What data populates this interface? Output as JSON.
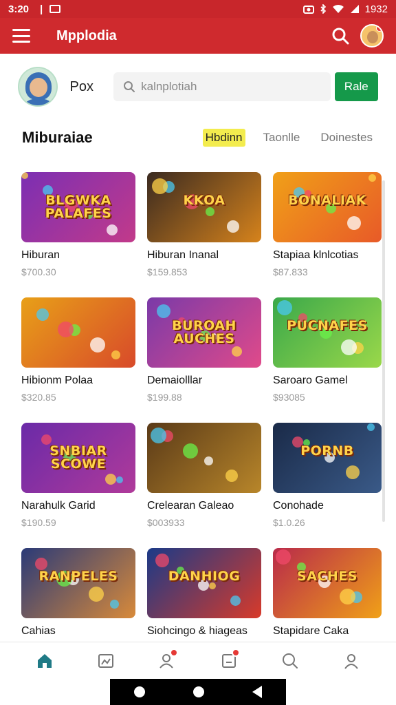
{
  "status_bar": {
    "time": "3:20",
    "clock_right": "1932"
  },
  "app": {
    "title": "Mpplodia"
  },
  "profile": {
    "name": "Pox"
  },
  "search": {
    "value": "kalnplotiah"
  },
  "rate_button": {
    "label": "Rale"
  },
  "section": {
    "title": "Miburaiae",
    "filters": [
      {
        "label": "Hbdinn",
        "active": true
      },
      {
        "label": "Taonlle",
        "active": false
      },
      {
        "label": "Doinestes",
        "active": false
      }
    ]
  },
  "games": [
    {
      "title": "Hiburan",
      "price": "$700.30",
      "art": "BLGWKA PALAFES",
      "colors": [
        "#7b2fb3",
        "#c23a8a"
      ]
    },
    {
      "title": "Hiburan Inanal",
      "price": "$159.853",
      "art": "KKOA",
      "colors": [
        "#3a2a20",
        "#d6831c"
      ]
    },
    {
      "title": "Stapiaa klnlcotias",
      "price": "$87.833",
      "art": "BONALIAK",
      "colors": [
        "#f0a018",
        "#e85a28"
      ]
    },
    {
      "title": "Hibionm Polaa",
      "price": "$320.85",
      "art": "",
      "colors": [
        "#e8a018",
        "#d84a2a"
      ]
    },
    {
      "title": "Demaiolllar",
      "price": "$199.88",
      "art": "BUROAH AUCHES",
      "colors": [
        "#7a3aa8",
        "#e04a8a"
      ]
    },
    {
      "title": "Saroaro Gamel",
      "price": "$93085",
      "art": "PUCNAFES",
      "colors": [
        "#3aa84a",
        "#9ad84a"
      ]
    },
    {
      "title": "Narahulk Garid",
      "price": "$190.59",
      "art": "SNBIAR SCOWE",
      "colors": [
        "#6a2aa8",
        "#b03a9a"
      ]
    },
    {
      "title": "Crelearan Galeao",
      "price": "$003933",
      "art": "",
      "colors": [
        "#5a3a18",
        "#b8862a"
      ]
    },
    {
      "title": "Conohade",
      "price": "$1.0.26",
      "art": "PORNB",
      "colors": [
        "#1a2a48",
        "#3a5a88"
      ]
    },
    {
      "title": "Cahias",
      "price": "",
      "art": "RANPELES",
      "colors": [
        "#2a3a78",
        "#d88a3a"
      ]
    },
    {
      "title": "Siohcingo & hiageas",
      "price": "",
      "art": "DANHIOG",
      "colors": [
        "#1a3a88",
        "#d83a2a"
      ]
    },
    {
      "title": "Stapidare Caka",
      "price": "",
      "art": "SACHES",
      "colors": [
        "#b82a4a",
        "#f0a018"
      ]
    }
  ],
  "bottom_nav": [
    "home-icon",
    "gallery-icon",
    "notifications-icon",
    "inbox-icon",
    "search-icon",
    "profile-icon"
  ],
  "colors": {
    "primary": "#cf2a2e",
    "accent_green": "#15994a",
    "chip_highlight": "#f3ec4e"
  }
}
